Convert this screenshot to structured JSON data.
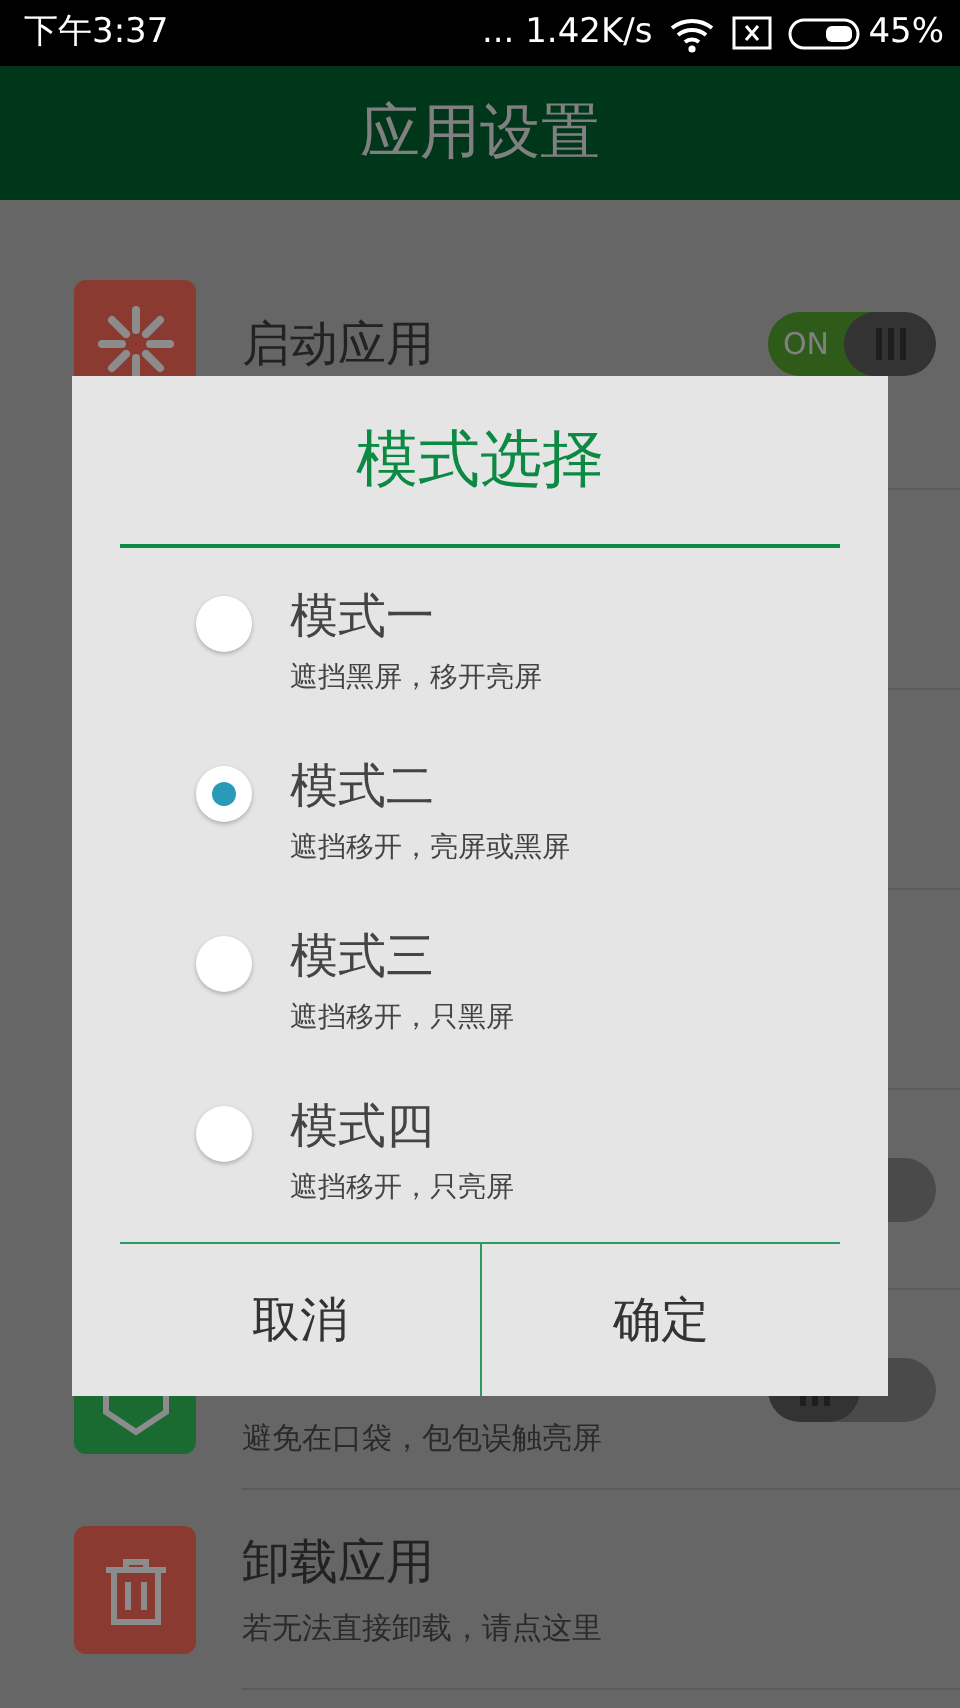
{
  "status_bar": {
    "time": "下午3:37",
    "network_speed": "... 1.42K/s",
    "battery": "45%"
  },
  "header": {
    "title": "应用设置"
  },
  "settings": [
    {
      "kind": "titled",
      "color": "#8a3a30",
      "title": "启动应用",
      "toggle": {
        "on": true,
        "label": "ON"
      }
    },
    {
      "kind": "covered"
    },
    {
      "kind": "covered"
    },
    {
      "kind": "covered"
    },
    {
      "kind": "covered",
      "toggle": {
        "on": false
      }
    },
    {
      "kind": "subtitled",
      "color": "#1a6a32",
      "subtitle": "避免在口袋，包包误触亮屏",
      "toggle": {
        "on": false
      }
    },
    {
      "kind": "titled",
      "color": "#8a3a30",
      "title": "卸载应用",
      "subtitle": "若无法直接卸载，请点这里"
    }
  ],
  "dialog": {
    "title": "模式选择",
    "options": [
      {
        "label": "模式一",
        "description": "遮挡黑屏，移开亮屏",
        "selected": false
      },
      {
        "label": "模式二",
        "description": "遮挡移开，亮屏或黑屏",
        "selected": true
      },
      {
        "label": "模式三",
        "description": "遮挡移开，只黑屏",
        "selected": false
      },
      {
        "label": "模式四",
        "description": "遮挡移开，只亮屏",
        "selected": false
      }
    ],
    "buttons": [
      "取消",
      "确定"
    ]
  }
}
